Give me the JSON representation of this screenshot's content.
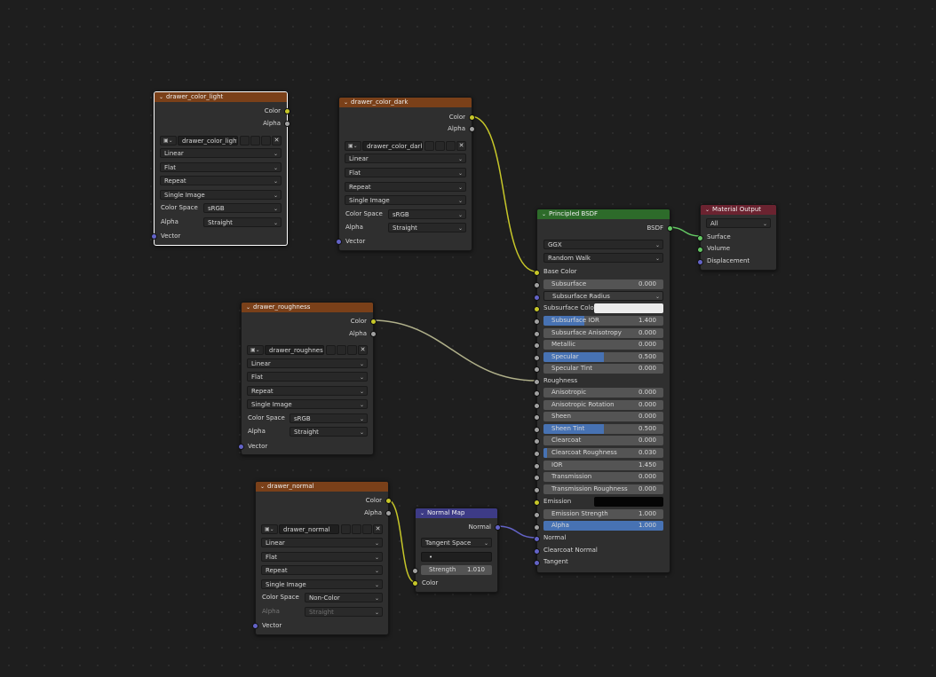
{
  "colors": {
    "background": "#1e1e1e",
    "texture_header": "#7a4019",
    "shader_header": "#2d6b2a",
    "vector_header": "#3d3b86",
    "output_header": "#6b2330",
    "socket_color": "#c7c729",
    "socket_float": "#a1a1a1",
    "socket_vector": "#6363c7",
    "socket_shader": "#63c763",
    "slider_fill": "#4772b3"
  },
  "image_nodes": [
    {
      "title": "drawer_color_light",
      "image_name": "drawer_color_light",
      "outputs": [
        "Color",
        "Alpha"
      ],
      "interpolation": "Linear",
      "projection": "Flat",
      "extension": "Repeat",
      "source": "Single Image",
      "color_space_label": "Color Space",
      "color_space": "sRGB",
      "alpha_label": "Alpha",
      "alpha": "Straight",
      "input": "Vector"
    },
    {
      "title": "drawer_color_dark",
      "image_name": "drawer_color_dark",
      "outputs": [
        "Color",
        "Alpha"
      ],
      "interpolation": "Linear",
      "projection": "Flat",
      "extension": "Repeat",
      "source": "Single Image",
      "color_space_label": "Color Space",
      "color_space": "sRGB",
      "alpha_label": "Alpha",
      "alpha": "Straight",
      "input": "Vector"
    },
    {
      "title": "drawer_roughness",
      "image_name": "drawer_roughness",
      "outputs": [
        "Color",
        "Alpha"
      ],
      "interpolation": "Linear",
      "projection": "Flat",
      "extension": "Repeat",
      "source": "Single Image",
      "color_space_label": "Color Space",
      "color_space": "sRGB",
      "alpha_label": "Alpha",
      "alpha": "Straight",
      "input": "Vector"
    },
    {
      "title": "drawer_normal",
      "image_name": "drawer_normal",
      "outputs": [
        "Color",
        "Alpha"
      ],
      "interpolation": "Linear",
      "projection": "Flat",
      "extension": "Repeat",
      "source": "Single Image",
      "color_space_label": "Color Space",
      "color_space": "Non-Color",
      "alpha_label": "Alpha",
      "alpha": "Straight",
      "input": "Vector"
    }
  ],
  "normal_map": {
    "title": "Normal Map",
    "output": "Normal",
    "space": "Tangent Space",
    "uv_map": "",
    "strength_label": "Strength",
    "strength": "1.010",
    "input": "Color"
  },
  "bsdf": {
    "title": "Principled BSDF",
    "output": "BSDF",
    "distribution": "GGX",
    "subsurface_method": "Random Walk",
    "base_color_label": "Base Color",
    "subsurface": {
      "label": "Subsurface",
      "value": "0.000",
      "fill": 0
    },
    "subsurface_radius": "Subsurface Radius",
    "subsurface_color_label": "Subsurface Color",
    "sliders_a": [
      {
        "label": "Subsurface IOR",
        "value": "1.400",
        "fill": 0.34
      },
      {
        "label": "Subsurface Anisotropy",
        "value": "0.000",
        "fill": 0
      },
      {
        "label": "Metallic",
        "value": "0.000",
        "fill": 0
      },
      {
        "label": "Specular",
        "value": "0.500",
        "fill": 0.5
      },
      {
        "label": "Specular Tint",
        "value": "0.000",
        "fill": 0
      }
    ],
    "roughness_label": "Roughness",
    "sliders_b": [
      {
        "label": "Anisotropic",
        "value": "0.000",
        "fill": 0
      },
      {
        "label": "Anisotropic Rotation",
        "value": "0.000",
        "fill": 0
      },
      {
        "label": "Sheen",
        "value": "0.000",
        "fill": 0
      },
      {
        "label": "Sheen Tint",
        "value": "0.500",
        "fill": 0.5
      },
      {
        "label": "Clearcoat",
        "value": "0.000",
        "fill": 0
      },
      {
        "label": "Clearcoat Roughness",
        "value": "0.030",
        "fill": 0.03
      },
      {
        "label": "IOR",
        "value": "1.450",
        "fill": 0
      },
      {
        "label": "Transmission",
        "value": "0.000",
        "fill": 0
      },
      {
        "label": "Transmission Roughness",
        "value": "0.000",
        "fill": 0
      }
    ],
    "emission_label": "Emission",
    "emission_strength": {
      "label": "Emission Strength",
      "value": "1.000",
      "fill": 0
    },
    "alpha": {
      "label": "Alpha",
      "value": "1.000",
      "fill": 1
    },
    "normal_label": "Normal",
    "clearcoat_normal_label": "Clearcoat Normal",
    "tangent_label": "Tangent"
  },
  "material_output": {
    "title": "Material Output",
    "target": "All",
    "inputs": [
      "Surface",
      "Volume",
      "Displacement"
    ]
  }
}
